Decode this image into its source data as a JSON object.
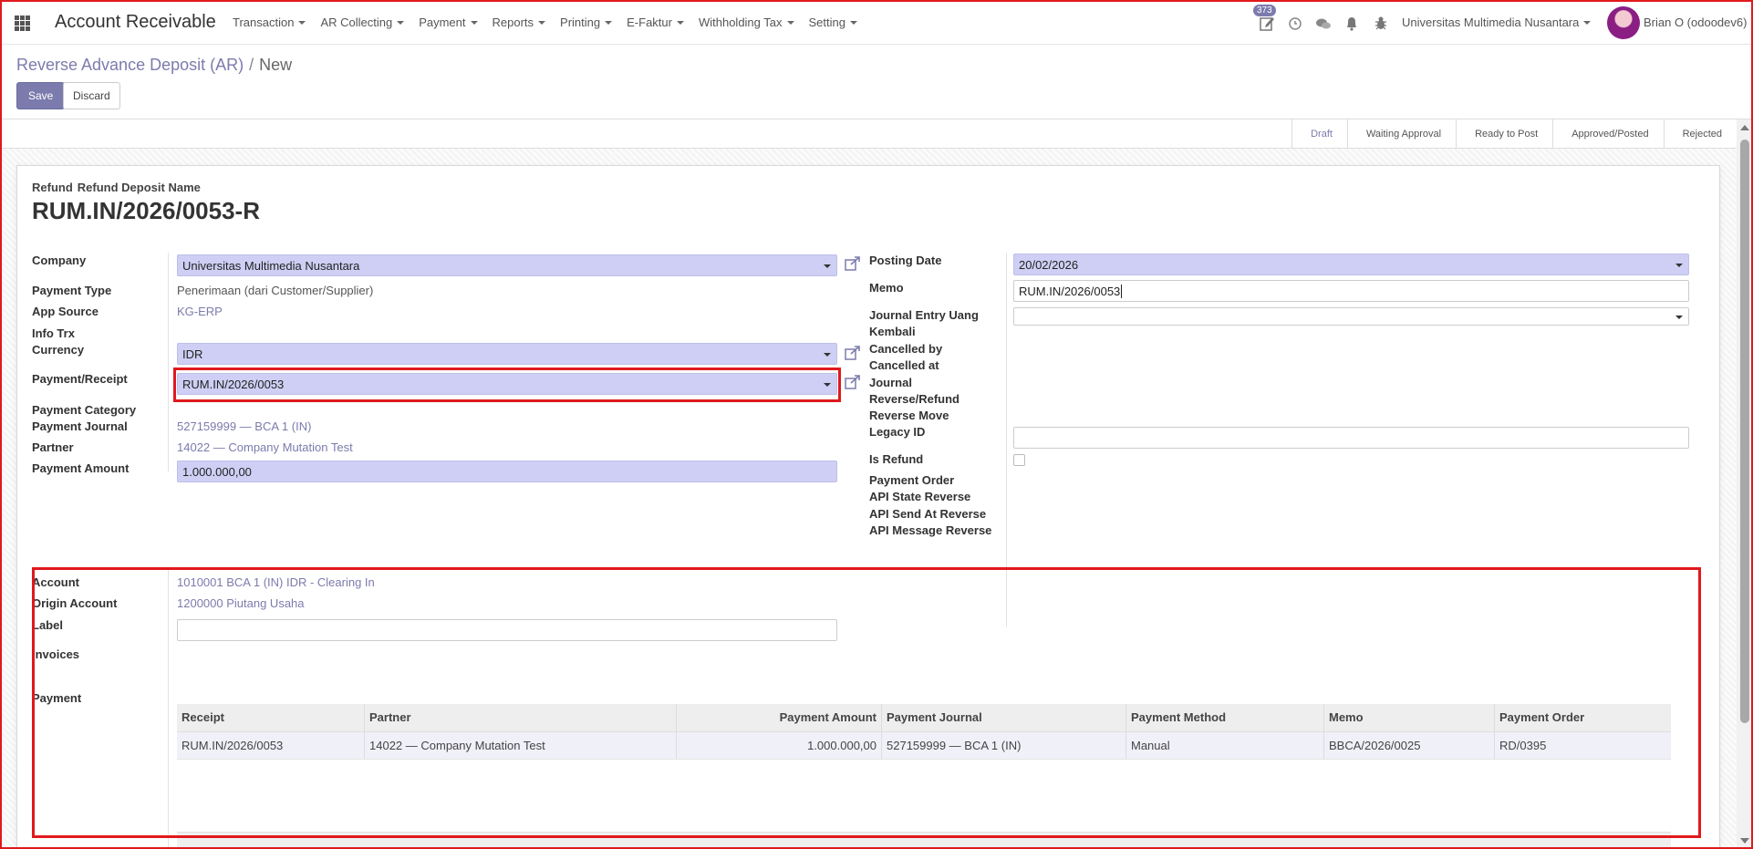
{
  "app": {
    "title": "Account Receivable"
  },
  "menu": [
    "Transaction",
    "AR Collecting",
    "Payment",
    "Reports",
    "Printing",
    "E-Faktur",
    "Withholding Tax",
    "Setting"
  ],
  "systray": {
    "activity_count": "373",
    "company": "Universitas Multimedia Nusantara",
    "user": "Brian O (odoodev6)"
  },
  "breadcrumb": {
    "parent": "Reverse Advance Deposit (AR)",
    "separator": "/",
    "current": "New"
  },
  "buttons": {
    "save": "Save",
    "discard": "Discard"
  },
  "stages": [
    {
      "label": "Draft",
      "active": true
    },
    {
      "label": "Waiting Approval",
      "active": false
    },
    {
      "label": "Ready to Post",
      "active": false
    },
    {
      "label": "Approved/Posted",
      "active": false
    },
    {
      "label": "Rejected",
      "active": false
    }
  ],
  "title": {
    "label_1": "Refund",
    "label_2": "Refund Deposit Name",
    "value": "RUM.IN/2026/0053-R"
  },
  "left": {
    "company_label": "Company",
    "company_value": "Universitas Multimedia Nusantara",
    "payment_type_label": "Payment Type",
    "payment_type_value": "Penerimaan (dari Customer/Supplier)",
    "app_source_label": "App Source",
    "app_source_value": "KG-ERP",
    "info_trx_label": "Info Trx",
    "currency_label": "Currency",
    "currency_value": "IDR",
    "payment_receipt_label": "Payment/Receipt",
    "payment_receipt_value": "RUM.IN/2026/0053",
    "payment_category_label": "Payment Category",
    "payment_journal_label": "Payment Journal",
    "payment_journal_value": "527159999 — BCA 1 (IN)",
    "partner_label": "Partner",
    "partner_value": "14022 — Company Mutation Test",
    "payment_amount_label": "Payment Amount",
    "payment_amount_value": "1.000.000,00"
  },
  "right": {
    "posting_date_label": "Posting Date",
    "posting_date_value": "20/02/2026",
    "memo_label": "Memo",
    "memo_value": "RUM.IN/2026/0053",
    "journal_entry_label_1": "Journal Entry Uang",
    "journal_entry_label_2": "Kembali",
    "journal_entry_value": "",
    "cancelled_by_label": "Cancelled by",
    "cancelled_at_label": "Cancelled at",
    "journal_reverse_label_1": "Journal",
    "journal_reverse_label_2": "Reverse/Refund",
    "reverse_move_label": "Reverse Move",
    "legacy_id_label": "Legacy ID",
    "legacy_id_value": "",
    "is_refund_label": "Is Refund",
    "payment_order_label": "Payment Order",
    "api_state_label": "API State Reverse",
    "api_send_label": "API Send At Reverse",
    "api_message_label": "API Message Reverse"
  },
  "lower": {
    "account_label": "Account",
    "account_value": "1010001 BCA 1 (IN) IDR - Clearing In",
    "origin_account_label": "Origin Account",
    "origin_account_value": "1200000 Piutang Usaha",
    "label_label": "Label",
    "label_value": "",
    "invoices_label": "Invoices",
    "payment_label": "Payment"
  },
  "payment_table": {
    "headers": [
      "Receipt",
      "Partner",
      "Payment Amount",
      "Payment Journal",
      "Payment Method",
      "Memo",
      "Payment Order"
    ],
    "rows": [
      [
        "RUM.IN/2026/0053",
        "14022 — Company Mutation Test",
        "1.000.000,00",
        "527159999 — BCA 1 (IN)",
        "Manual",
        "BBCA/2026/0025",
        "RD/0395"
      ]
    ]
  },
  "colors": {
    "accent": "#7c7bad",
    "highlight_border": "#e0191d",
    "required_field": "#cfcff5"
  }
}
